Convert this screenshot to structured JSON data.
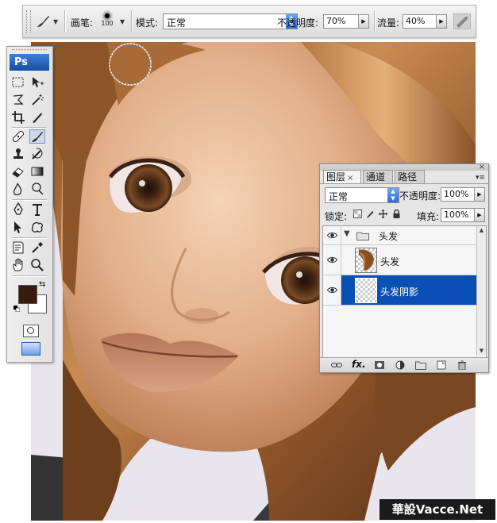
{
  "options_bar": {
    "brush_label": "画笔:",
    "brush_size": "100",
    "mode_label": "模式:",
    "mode_value": "正常",
    "opacity_label": "不透明度:",
    "opacity_value": "70%",
    "flow_label": "流量:",
    "flow_value": "40%"
  },
  "toolbox": {
    "logo": "Ps",
    "fg_color": "#3a1a0a",
    "bg_color": "#ffffff"
  },
  "layers_panel": {
    "tabs": [
      {
        "label": "图层",
        "active": true
      },
      {
        "label": "通道",
        "active": false
      },
      {
        "label": "路径",
        "active": false
      }
    ],
    "blend_mode": "正常",
    "opacity_label": "不透明度:",
    "opacity_value": "100%",
    "lock_label": "锁定:",
    "fill_label": "填充:",
    "fill_value": "100%",
    "layers": [
      {
        "name": "头发",
        "type": "group",
        "visible": true,
        "selected": false
      },
      {
        "name": "头发",
        "type": "layer",
        "visible": true,
        "selected": false
      },
      {
        "name": "头发阴影",
        "type": "layer",
        "visible": true,
        "selected": true
      }
    ]
  },
  "watermark": {
    "text": "華設Vacce.Net"
  },
  "colors": {
    "selection_blue": "#0a50b4",
    "hair_brown": "#8a5228",
    "skin": "#e6b48c"
  }
}
